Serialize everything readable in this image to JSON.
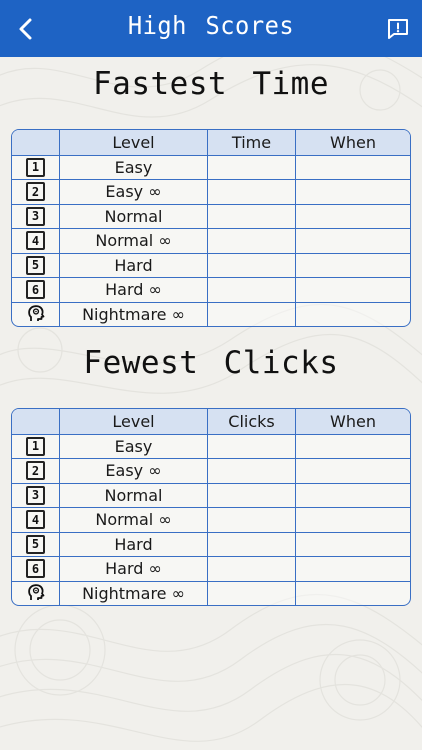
{
  "header": {
    "title": "High Scores"
  },
  "colors": {
    "navbar": "#1e63c4",
    "table_border": "#3a6fc4",
    "table_header": "#d6e1f2",
    "background": "#f1f0ec"
  },
  "sections": [
    {
      "title": "Fastest Time",
      "columns": [
        "",
        "Level",
        "Time",
        "When"
      ],
      "rows": [
        {
          "icon": "1",
          "level": "Easy",
          "value": "",
          "when": ""
        },
        {
          "icon": "2",
          "level": "Easy ∞",
          "value": "",
          "when": ""
        },
        {
          "icon": "3",
          "level": "Normal",
          "value": "",
          "when": ""
        },
        {
          "icon": "4",
          "level": "Normal ∞",
          "value": "",
          "when": ""
        },
        {
          "icon": "5",
          "level": "Hard",
          "value": "",
          "when": ""
        },
        {
          "icon": "6",
          "level": "Hard ∞",
          "value": "",
          "when": ""
        },
        {
          "icon": "brain-head-icon",
          "level": "Nightmare ∞",
          "value": "",
          "when": ""
        }
      ]
    },
    {
      "title": "Fewest Clicks",
      "columns": [
        "",
        "Level",
        "Clicks",
        "When"
      ],
      "rows": [
        {
          "icon": "1",
          "level": "Easy",
          "value": "",
          "when": ""
        },
        {
          "icon": "2",
          "level": "Easy ∞",
          "value": "",
          "when": ""
        },
        {
          "icon": "3",
          "level": "Normal",
          "value": "",
          "when": ""
        },
        {
          "icon": "4",
          "level": "Normal ∞",
          "value": "",
          "when": ""
        },
        {
          "icon": "5",
          "level": "Hard",
          "value": "",
          "when": ""
        },
        {
          "icon": "6",
          "level": "Hard ∞",
          "value": "",
          "when": ""
        },
        {
          "icon": "brain-head-icon",
          "level": "Nightmare ∞",
          "value": "",
          "when": ""
        }
      ]
    }
  ]
}
